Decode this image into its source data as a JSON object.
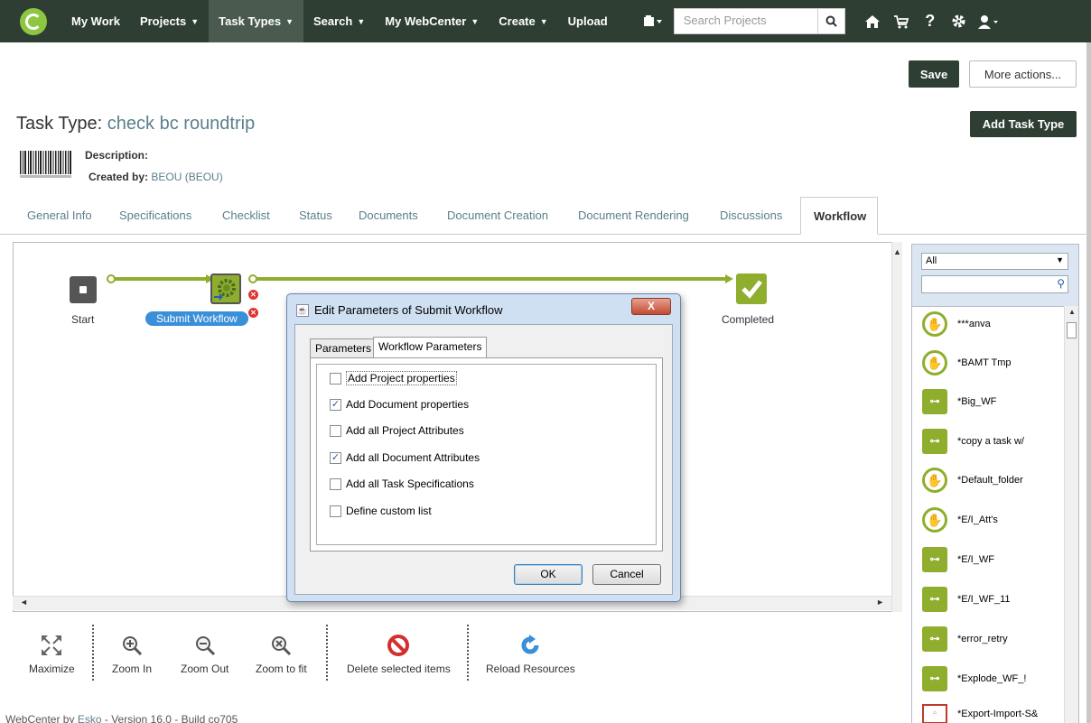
{
  "topnav": {
    "items": [
      {
        "label": "My Work",
        "caret": false
      },
      {
        "label": "Projects",
        "caret": true
      },
      {
        "label": "Task Types",
        "caret": true
      },
      {
        "label": "Search",
        "caret": true
      },
      {
        "label": "My WebCenter",
        "caret": true
      },
      {
        "label": "Create",
        "caret": true
      },
      {
        "label": "Upload",
        "caret": false
      }
    ],
    "search_placeholder": "Search Projects"
  },
  "actions": {
    "save_label": "Save",
    "more_actions_label": "More actions...",
    "add_task_type_label": "Add Task Type"
  },
  "header": {
    "title_prefix": "Task Type:",
    "title_name": "check bc roundtrip",
    "description_label": "Description:",
    "created_by_label": "Created by:",
    "created_by_value": "BEOU (BEOU)"
  },
  "tabs": [
    "General Info",
    "Specifications",
    "Checklist",
    "Status",
    "Documents",
    "Document Creation",
    "Document Rendering",
    "Discussions",
    "Workflow"
  ],
  "workflow": {
    "start_label": "Start",
    "submit_label": "Submit Workflow",
    "completed_label": "Completed"
  },
  "dialog": {
    "title": "Edit Parameters of Submit Workflow",
    "close_label": "X",
    "tabs": [
      "Parameters",
      "Workflow Parameters"
    ],
    "options": [
      {
        "label": "Add Project properties",
        "checked": false
      },
      {
        "label": "Add Document properties",
        "checked": true
      },
      {
        "label": "Add all Project Attributes",
        "checked": false
      },
      {
        "label": "Add all Document Attributes",
        "checked": true
      },
      {
        "label": "Add all Task Specifications",
        "checked": false
      },
      {
        "label": "Define custom list",
        "checked": false
      }
    ],
    "ok_label": "OK",
    "cancel_label": "Cancel"
  },
  "toolbar": {
    "maximize": "Maximize",
    "zoom_in": "Zoom In",
    "zoom_out": "Zoom Out",
    "zoom_fit": "Zoom to fit",
    "delete": "Delete selected items",
    "reload": "Reload Resources"
  },
  "footer": {
    "prefix": "WebCenter by",
    "link": "Esko",
    "suffix": "- Version 16.0 - Build co705"
  },
  "right_panel": {
    "filter_value": "All",
    "items": [
      {
        "label": "***anva",
        "icon": "hand"
      },
      {
        "label": "*BAMT Tmp",
        "icon": "hand"
      },
      {
        "label": "*Big_WF",
        "icon": "workflow"
      },
      {
        "label": "*copy a task w/",
        "icon": "workflow"
      },
      {
        "label": "*Default_folder",
        "icon": "hand"
      },
      {
        "label": "*E/I_Att's",
        "icon": "hand"
      },
      {
        "label": "*E/I_WF",
        "icon": "workflow"
      },
      {
        "label": "*E/I_WF_11",
        "icon": "workflow"
      },
      {
        "label": "*error_retry",
        "icon": "workflow"
      },
      {
        "label": "*Explode_WF_!",
        "icon": "workflow"
      },
      {
        "label": "*Export-Import-S&",
        "icon": "house"
      }
    ]
  },
  "colors": {
    "nav_bg": "#2e3e33",
    "accent_link": "#5a7f8c",
    "workflow_green": "#8fae2e",
    "selection_blue": "#3a8fd9"
  }
}
